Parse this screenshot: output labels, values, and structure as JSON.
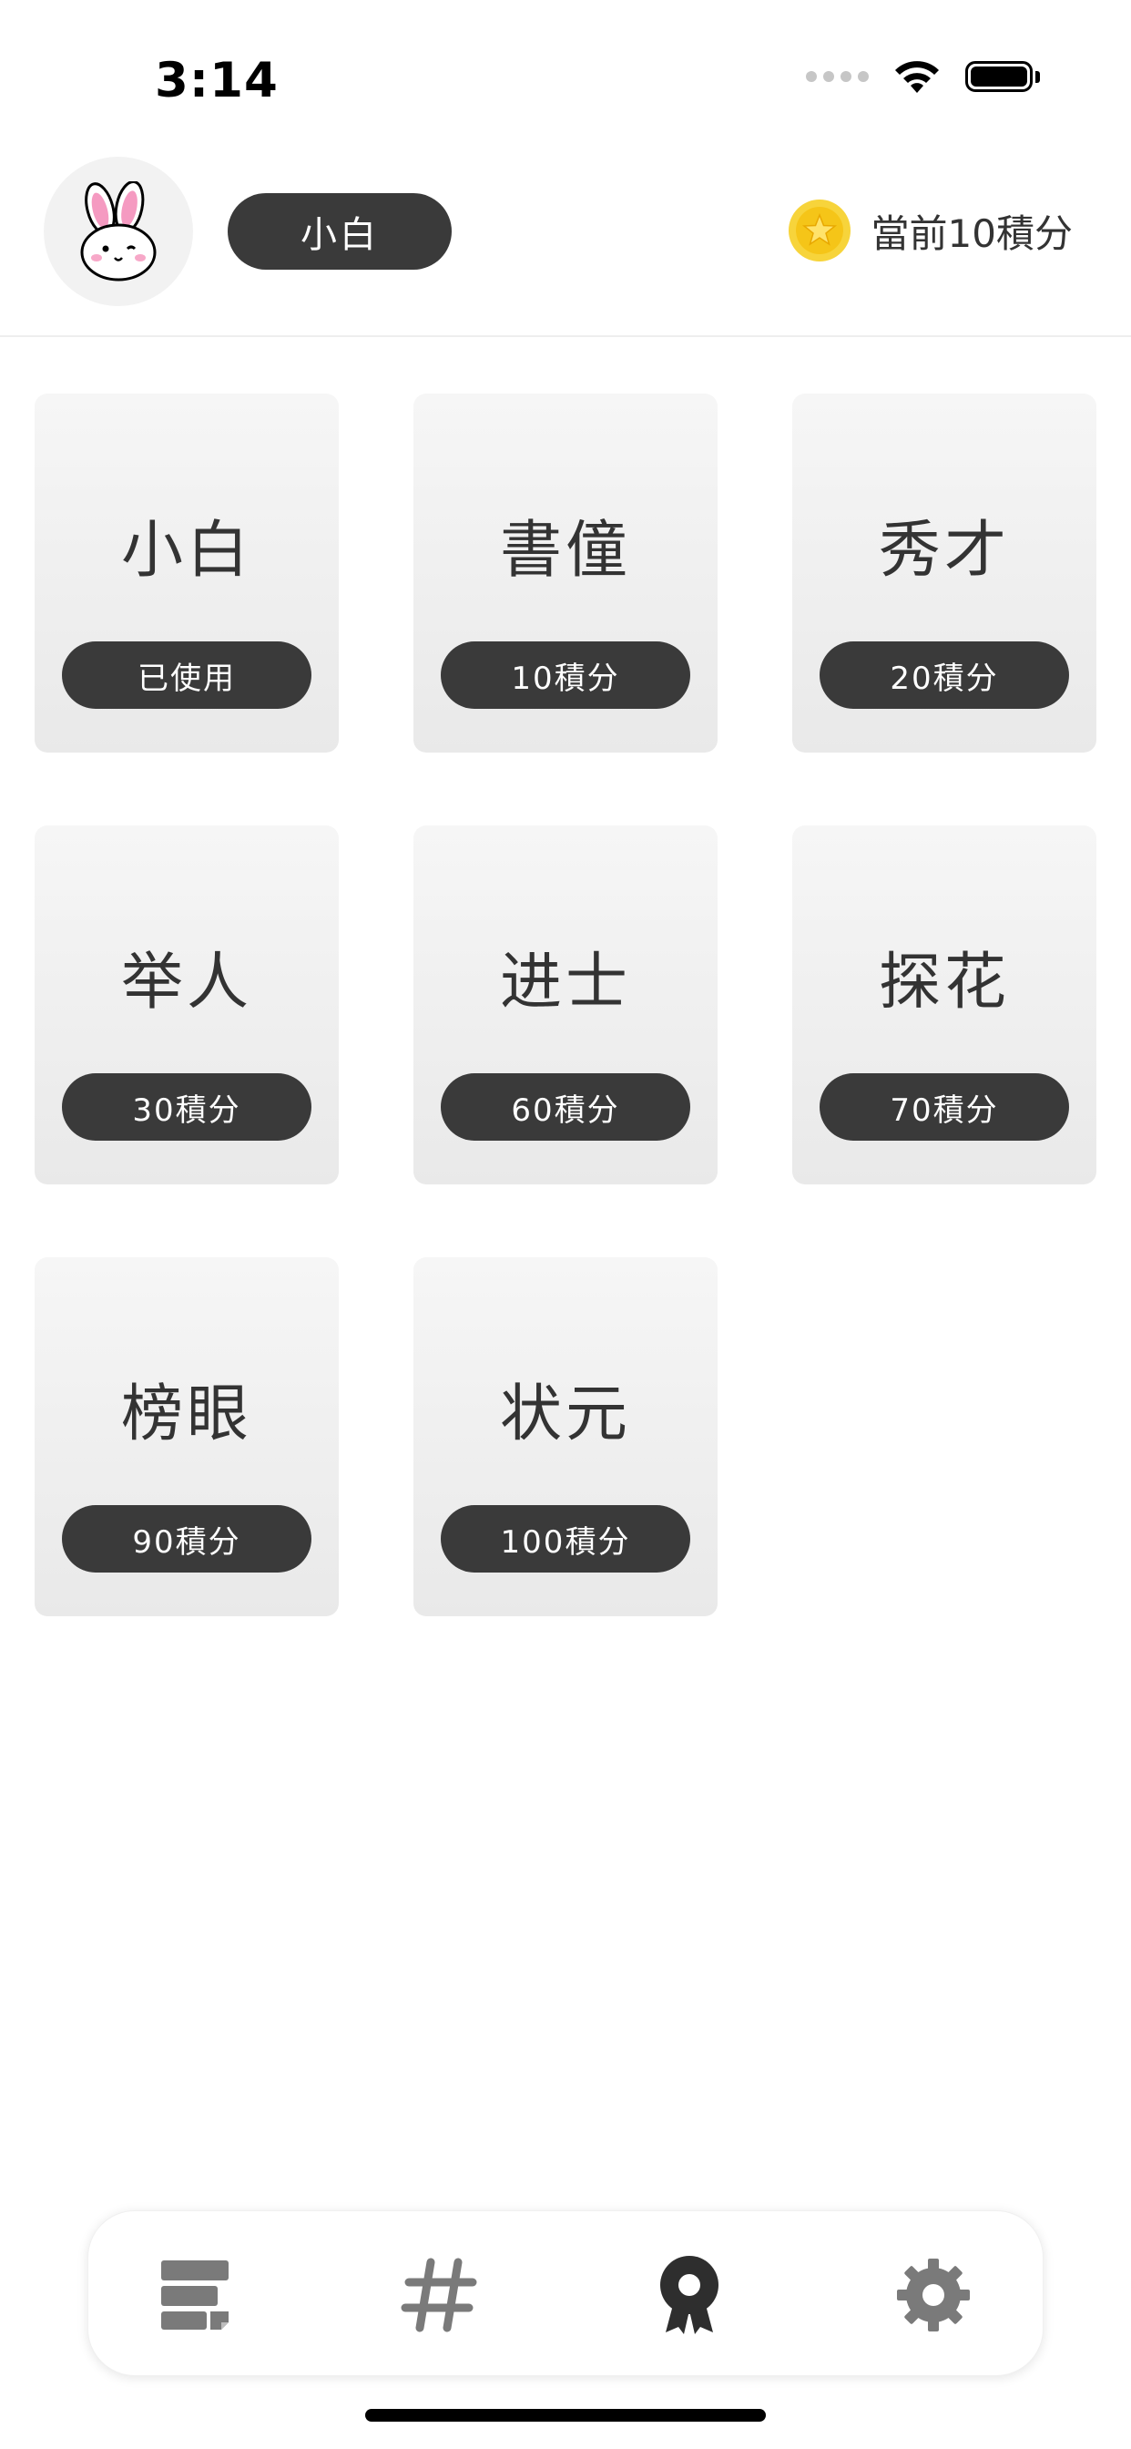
{
  "status_bar": {
    "time": "3:14"
  },
  "header": {
    "avatar_icon": "bunny-avatar",
    "current_title": "小白",
    "points_icon": "star-coin-icon",
    "points_text": "當前10積分"
  },
  "ranks": [
    {
      "title": "小白",
      "status": "已使用"
    },
    {
      "title": "書僮",
      "status": "10積分"
    },
    {
      "title": "秀才",
      "status": "20積分"
    },
    {
      "title": "举人",
      "status": "30積分"
    },
    {
      "title": "进士",
      "status": "60積分"
    },
    {
      "title": "探花",
      "status": "70積分"
    },
    {
      "title": "榜眼",
      "status": "90積分"
    },
    {
      "title": "状元",
      "status": "100積分"
    }
  ],
  "tab_bar": {
    "items": [
      {
        "icon": "notes-icon",
        "active": false
      },
      {
        "icon": "hashtag-icon",
        "active": false
      },
      {
        "icon": "medal-icon",
        "active": true
      },
      {
        "icon": "gear-icon",
        "active": false
      }
    ]
  },
  "colors": {
    "pill_background": "#3a3a3a",
    "card_top": "#f6f6f6",
    "card_bottom": "#e9e9e9",
    "tab_icon_inactive": "#7a7a7a",
    "tab_icon_active": "#2e2e2e",
    "coin": "#f5c518"
  }
}
